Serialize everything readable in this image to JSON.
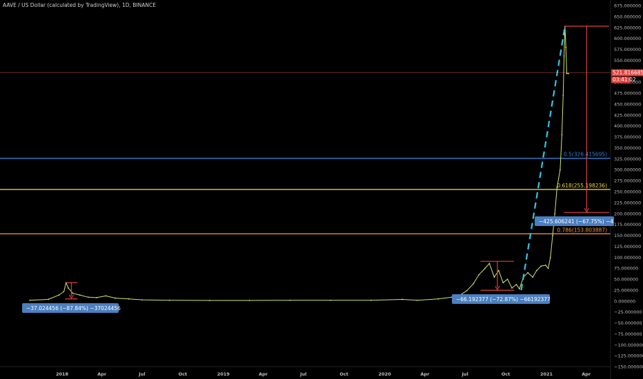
{
  "header": {
    "title": "AAVE / US Dollar (calculated by TradingView), 1D, BINANCE"
  },
  "price_label": {
    "price": "521.816685",
    "countdown": "03:41:02"
  },
  "fib_levels": [
    {
      "label": "0.5(326.415695)",
      "value": 326.415695,
      "color": "#2e7fd6"
    },
    {
      "label": "0.618(255.198236)",
      "value": 255.198236,
      "color": "#e8d43a"
    },
    {
      "label": "0.786(153.803887)",
      "value": 153.803887,
      "color": "#f0922b"
    }
  ],
  "measures": [
    {
      "label": "−37.024456 (−87.84%) −37024456",
      "from": 42.1,
      "to": 5.1,
      "date": "2018-01-20"
    },
    {
      "label": "−66.192377 (−72.87%) −66192377",
      "from": 91.0,
      "to": 24.8,
      "date": "2020-09-03"
    },
    {
      "label": "−425.606241 (−67.75%) −4",
      "from": 628.2,
      "to": 202.6,
      "date": "2021-03-15"
    }
  ],
  "chart_data": {
    "type": "line",
    "title": "AAVE / US Dollar (calculated by TradingView), 1D, BINANCE",
    "xlabel": "",
    "ylabel": "",
    "ylim": [
      -160,
      690
    ],
    "y_ticks": [
      "675.000000",
      "650.000000",
      "625.000000",
      "600.000000",
      "575.000000",
      "550.000000",
      "525.000000",
      "500.000000",
      "475.000000",
      "450.000000",
      "425.000000",
      "400.000000",
      "375.000000",
      "350.000000",
      "325.000000",
      "300.000000",
      "275.000000",
      "250.000000",
      "225.000000",
      "200.000000",
      "175.000000",
      "150.000000",
      "125.000000",
      "100.000000",
      "75.000000",
      "50.000000",
      "25.000000",
      "0.000000",
      "−25.000000",
      "−50.000000",
      "−75.000000",
      "−100.000000",
      "−125.000000",
      "−150.000000"
    ],
    "x_ticks": [
      "2018",
      "Apr",
      "Jul",
      "Oct",
      "2019",
      "Apr",
      "Jul",
      "Oct",
      "2020",
      "Apr",
      "Jul",
      "Oct",
      "2021",
      "Apr"
    ],
    "grid": false,
    "series": [
      {
        "color": "#d4e86a",
        "x": [
          "2017-10-20",
          "2017-12-01",
          "2017-12-25",
          "2018-01-05",
          "2018-01-10",
          "2018-01-15",
          "2018-01-25",
          "2018-02-10",
          "2018-03-01",
          "2018-03-20",
          "2018-04-10",
          "2018-05-01",
          "2018-06-01",
          "2018-07-01",
          "2018-09-01",
          "2018-12-01",
          "2019-03-01",
          "2019-06-01",
          "2019-09-01",
          "2019-12-01",
          "2020-02-10",
          "2020-03-15",
          "2020-05-01",
          "2020-06-01",
          "2020-06-20",
          "2020-07-05",
          "2020-07-20",
          "2020-08-01",
          "2020-08-15",
          "2020-08-25",
          "2020-09-05",
          "2020-09-15",
          "2020-09-25",
          "2020-10-05",
          "2020-10-15",
          "2020-10-25",
          "2020-11-01",
          "2020-11-10",
          "2020-11-20",
          "2020-12-01",
          "2020-12-10",
          "2020-12-20",
          "2020-12-30",
          "2021-01-05",
          "2021-01-10",
          "2021-01-15",
          "2021-01-20",
          "2021-01-25",
          "2021-02-01",
          "2021-02-05",
          "2021-02-08",
          "2021-02-10",
          "2021-02-12",
          "2021-02-14",
          "2021-02-16",
          "2021-02-20"
        ],
        "values": [
          2,
          4,
          14,
          22,
          42,
          30,
          18,
          14,
          9,
          8,
          12,
          7,
          5,
          3,
          2,
          1.5,
          1.5,
          2,
          2,
          2,
          4,
          2,
          5,
          9,
          14,
          24,
          40,
          60,
          75,
          86,
          55,
          70,
          42,
          50,
          30,
          38,
          28,
          55,
          65,
          55,
          70,
          80,
          82,
          75,
          100,
          150,
          200,
          260,
          300,
          380,
          470,
          560,
          628,
          580,
          520,
          520
        ]
      }
    ]
  }
}
